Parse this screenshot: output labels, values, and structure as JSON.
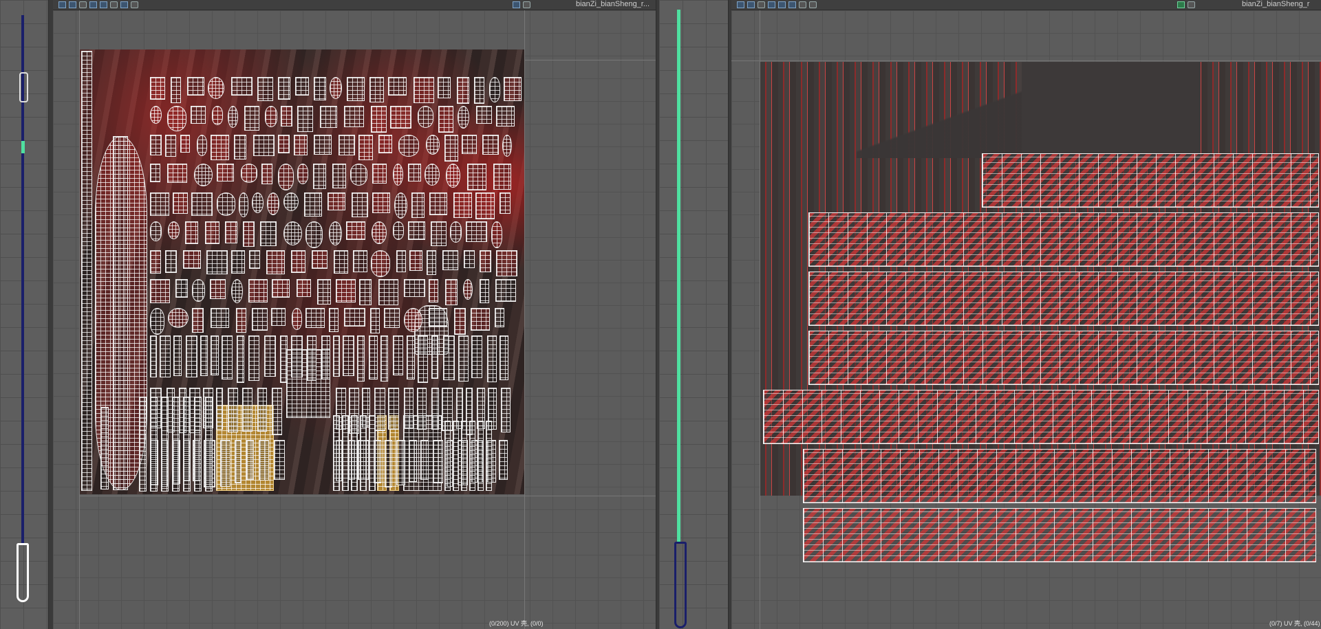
{
  "left_panel": {
    "title": "bianZi_bianSheng_r..."
  },
  "right_panel": {
    "title": "bianZi_bianSheng_r"
  },
  "status": {
    "left": "(0/200) UV 壳, (0/0)",
    "right": "(0/7) UV 壳, (0/44)"
  },
  "colors": {
    "panel_bg": "#4a4a4a",
    "grid": "#5e5e5e",
    "wire": "#f2f2f2",
    "accent_green": "#4fe0a0",
    "accent_navy": "#1a1f6a",
    "uv_red": "#b02a2a",
    "uv_gold": "#d0a040"
  },
  "icons": [
    "uv-toolbar-icon",
    "texture-toggle-icon",
    "checker-icon",
    "uv-shell-icon"
  ]
}
